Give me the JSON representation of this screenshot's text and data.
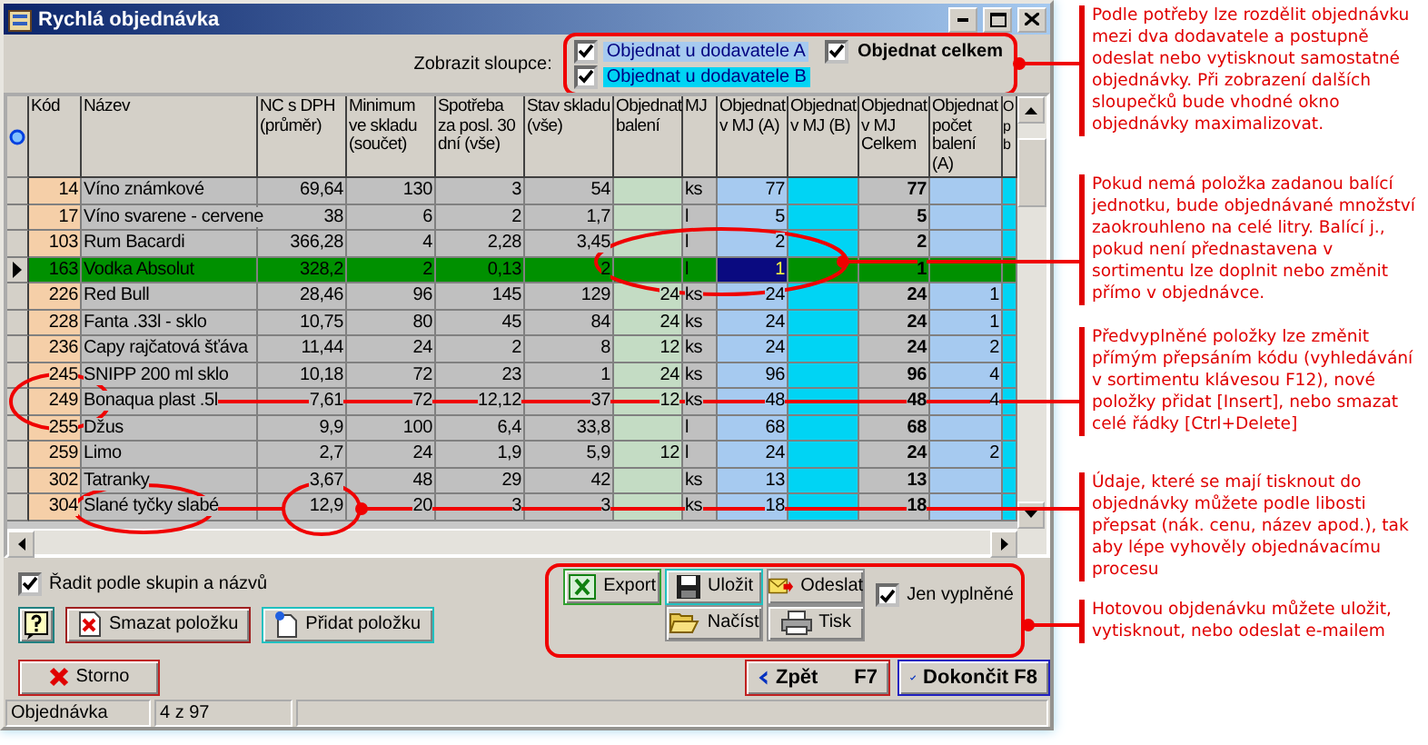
{
  "window": {
    "title": "Rychlá objednávka"
  },
  "column_toggles": {
    "label": "Zobrazit sloupce:",
    "items": [
      {
        "label": "Objednat u dodavatele A",
        "checked": true,
        "color": "#a6caf0"
      },
      {
        "label": "Objednat celkem",
        "checked": true
      },
      {
        "label": "Objednat u dodavatele B",
        "checked": true,
        "color": "#00d4f4"
      }
    ]
  },
  "table": {
    "columns": [
      {
        "label": "Kód",
        "kind": "number",
        "color": "#f5cfa8"
      },
      {
        "label": "Název",
        "kind": "text",
        "color": "#c0c0c0"
      },
      {
        "label": "NC s DPH (průměr)",
        "kind": "number",
        "color": "#c0c0c0"
      },
      {
        "label": "Minimum ve skladu (součet)",
        "kind": "number",
        "color": "#c0c0c0"
      },
      {
        "label": "Spotřeba za posl. 30 dní (vše)",
        "kind": "number",
        "color": "#c0c0c0"
      },
      {
        "label": "Stav skladu (vše)",
        "kind": "number",
        "color": "#c0c0c0"
      },
      {
        "label": "Objednat balení",
        "kind": "number",
        "color": "#c4dcc4"
      },
      {
        "label": "MJ",
        "kind": "text",
        "color": "#c0c0c0"
      },
      {
        "label": "Objednat v MJ (A)",
        "kind": "number",
        "color": "#a6caf0"
      },
      {
        "label": "Objednat v MJ (B)",
        "kind": "number",
        "color": "#00d4f4"
      },
      {
        "label": "Objednat v MJ Celkem",
        "kind": "total",
        "color": "#c0c0c0"
      },
      {
        "label": "Objednat počet balení (A)",
        "kind": "number",
        "color": "#a6caf0"
      },
      {
        "label": "O p b",
        "kind": "number",
        "color": "#00d4f4"
      }
    ],
    "rows": [
      {
        "selected": false,
        "cells": [
          "14",
          "Víno známkové",
          "69,64",
          "130",
          "3",
          "54",
          null,
          "ks",
          "77",
          null,
          "77",
          null,
          null
        ]
      },
      {
        "selected": false,
        "cells": [
          "17",
          "Víno svarene - cervene",
          "38",
          "6",
          "2",
          "1,7",
          null,
          "l",
          "5",
          null,
          "5",
          null,
          null
        ]
      },
      {
        "selected": false,
        "cells": [
          "103",
          "Rum Bacardi",
          "366,28",
          "4",
          "2,28",
          "3,45",
          null,
          "l",
          "2",
          null,
          "2",
          null,
          null
        ]
      },
      {
        "selected": true,
        "cells": [
          "163",
          "Vodka Absolut",
          "328,2",
          "2",
          "0,13",
          "2",
          null,
          "l",
          {
            "text": "1",
            "focused": true
          },
          null,
          "1",
          null,
          null
        ]
      },
      {
        "selected": false,
        "cells": [
          "226",
          "Red Bull",
          "28,46",
          "96",
          "145",
          "129",
          "24",
          "ks",
          "24",
          null,
          "24",
          "1",
          null
        ]
      },
      {
        "selected": false,
        "cells": [
          "228",
          "Fanta .33l - sklo",
          "10,75",
          "80",
          "45",
          "84",
          "24",
          "ks",
          "24",
          null,
          "24",
          "1",
          null
        ]
      },
      {
        "selected": false,
        "cells": [
          "236",
          "Capy rajčatová šťáva",
          "11,44",
          "24",
          "2",
          "8",
          "12",
          "ks",
          "24",
          null,
          "24",
          "2",
          null
        ]
      },
      {
        "selected": false,
        "cells": [
          "245",
          "SNIPP 200 ml sklo",
          "10,18",
          "72",
          "23",
          "1",
          "24",
          "ks",
          "96",
          null,
          "96",
          "4",
          null
        ]
      },
      {
        "selected": false,
        "cells": [
          "249",
          "Bonaqua plast .5l",
          "7,61",
          "72",
          "12,12",
          "37",
          "12",
          "ks",
          "48",
          null,
          "48",
          "4",
          null
        ]
      },
      {
        "selected": false,
        "cells": [
          "255",
          "Džus",
          "9,9",
          "100",
          "6,4",
          "33,8",
          null,
          "l",
          "68",
          null,
          "68",
          null,
          null
        ]
      },
      {
        "selected": false,
        "cells": [
          "259",
          "Limo",
          "2,7",
          "24",
          "1,9",
          "5,9",
          "12",
          "l",
          "24",
          null,
          "24",
          "2",
          null
        ]
      },
      {
        "selected": false,
        "cells": [
          "302",
          "Tatranky",
          "3,67",
          "48",
          "29",
          "42",
          null,
          "ks",
          "13",
          null,
          "13",
          null,
          null
        ]
      },
      {
        "selected": false,
        "cells": [
          "304",
          "Slané tyčky slabé",
          "12,9",
          "20",
          "3",
          "3",
          null,
          "ks",
          "18",
          null,
          "18",
          null,
          null
        ]
      }
    ]
  },
  "sort_option": {
    "label": "Řadit podle skupin a názvů",
    "checked": true
  },
  "item_buttons": [
    {
      "kind": "help"
    },
    {
      "kind": "delete",
      "label": "Smazat položku"
    },
    {
      "kind": "add",
      "label": "Přidat položku"
    }
  ],
  "actions": {
    "buttons": [
      {
        "kind": "export",
        "label": "Export"
      },
      {
        "kind": "save",
        "label": "Uložit"
      },
      {
        "kind": "send",
        "label": "Odeslat"
      },
      {
        "kind": "open",
        "label": "Načíst"
      },
      {
        "kind": "print",
        "label": "Tisk"
      }
    ],
    "filled_only": {
      "label": "Jen vyplněné",
      "checked": true
    }
  },
  "footer": {
    "buttons": [
      {
        "kind": "cancel",
        "label": "Storno"
      },
      {
        "kind": "back",
        "label": "Zpět",
        "shortcut": "F7"
      },
      {
        "kind": "finish",
        "label": "Dokončit",
        "shortcut": "F8"
      }
    ]
  },
  "status_bar": [
    "Objednávka",
    "4 z 97"
  ],
  "annotations": [
    {
      "text": "Podle potřeby lze rozdělit objednávku mezi dva dodavatele a postupně odeslat nebo vytisknout samostatné objednávky.  Při zobrazení dalších sloupečků bude vhodné okno objednávky maximalizovat."
    },
    {
      "text": "Pokud nemá položka zadanou balící jednotku, bude objednávané množství zaokrouhleno na celé litry. Balící j., pokud není přednastavena v sortimentu lze doplnit nebo změnit přímo v objednávce."
    },
    {
      "text": "Předvyplněné položky lze změnit přímým přepsáním kódu (vyhledávání v sortimentu klávesou F12), nové položky přidat [Insert], nebo smazat celé řádky [Ctrl+Delete]"
    },
    {
      "text": "Údaje, které se mají tisknout do objednávky můžete podle libosti přepsat (nák. cenu, název apod.), tak aby lépe vyhověly objednávacímu procesu"
    },
    {
      "text": "Hotovou objdenávku můžete uložit, vytisknout, nebo odeslat e-mailem"
    }
  ]
}
